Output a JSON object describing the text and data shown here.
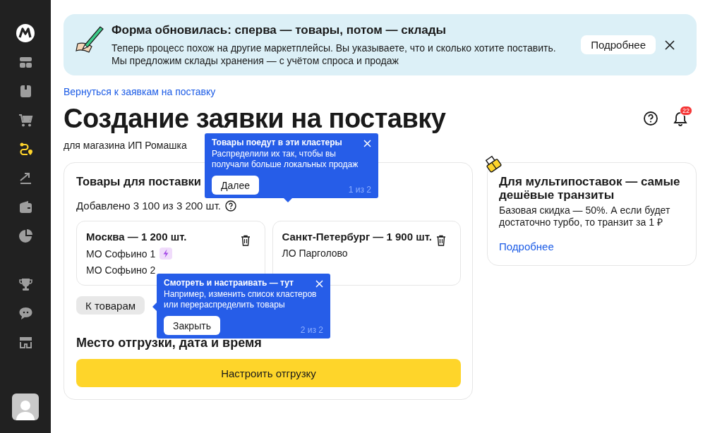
{
  "sidebar": {
    "items": [
      {
        "kind": "dashboard",
        "selected": false
      },
      {
        "kind": "box",
        "selected": false
      },
      {
        "kind": "cart",
        "selected": false
      },
      {
        "kind": "route",
        "selected": true
      },
      {
        "kind": "growth",
        "selected": false
      },
      {
        "kind": "wallet",
        "selected": false
      },
      {
        "kind": "pie",
        "selected": false
      },
      {
        "kind": "trophy",
        "selected": false
      },
      {
        "kind": "chat",
        "selected": false
      },
      {
        "kind": "store",
        "selected": false
      }
    ]
  },
  "banner": {
    "title": "Форма обновилась: сперва — товары, потом — склады",
    "lines": [
      "Теперь процесс похож на другие маркетплейсы. Вы указываете, что и сколько хотите поставить.",
      "Мы предложим склады хранения — с учётом спроса и продаж"
    ],
    "button": "Подробнее"
  },
  "back_link": "Вернуться к заявкам на поставку",
  "page_title": "Создание заявки на поставку",
  "subtitle": "для магазина ИП Ромашка",
  "notifications": {
    "count": "22"
  },
  "supply_card": {
    "title": "Товары для поставки",
    "added": "Добавлено 3 100 из 3 200 шт.",
    "clusters": [
      {
        "title": "Москва — 1 200 шт.",
        "warehouses": [
          {
            "name": "МО Софьино 1",
            "turbo": true
          },
          {
            "name": "МО Софьино 2",
            "turbo": false
          }
        ]
      },
      {
        "title": "Санкт-Петербург — 1 900 шт.",
        "warehouses": [
          {
            "name": "ЛО Парголово",
            "turbo": false
          }
        ]
      }
    ],
    "goods_button": "К товарам",
    "shipment_title": "Место отгрузки, дата и время",
    "configure_button": "Настроить отгрузку"
  },
  "promo_card": {
    "title": "Для мультипоставок — самые дешёвые транзиты",
    "text": "Базовая скидка — 50%. А если будет достаточно турбо, то транзит за 1 ₽",
    "link": "Подробнее"
  },
  "tooltips": [
    {
      "title": "Товары поедут в эти кластеры",
      "text": "Распределили их так, чтобы вы получали больше локальных продаж",
      "button": "Далее",
      "step": "1 из 2"
    },
    {
      "title": "Смотреть и настраивать — тут",
      "text": "Например, изменить список кластеров или перераспределить товары",
      "button": "Закрыть",
      "step": "2 из 2"
    }
  ]
}
